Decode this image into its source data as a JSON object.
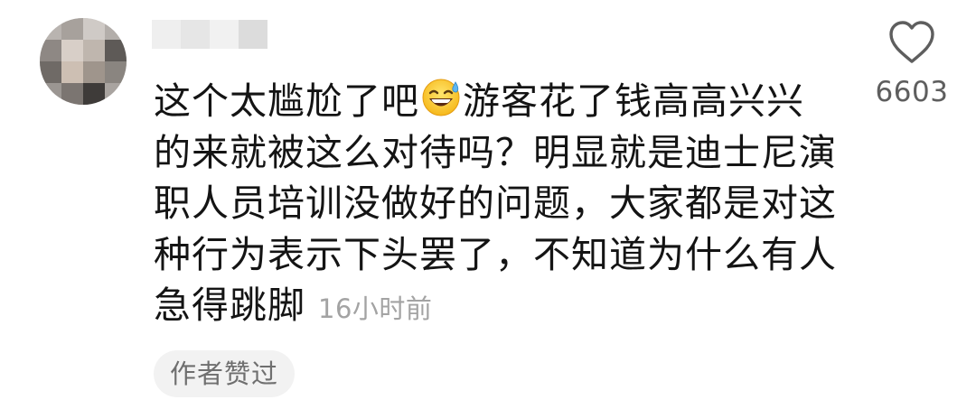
{
  "comment": {
    "text_lines": [
      [
        "这个太尴尬了吧",
        "游客花了钱高高兴兴"
      ],
      "的来就被这么对待吗？明显就是迪士尼演",
      "职人员培训没做好的问题，大家都是对这",
      "种行为表示下头罢了，不知道为什么有人",
      "急得跳脚"
    ],
    "emoji_icon": "sweat-smile-emoji",
    "time": "16小时前",
    "author_liked": "作者赞过",
    "like_count": "6603"
  },
  "icons": {
    "like": "heart-outline-icon"
  },
  "colors": {
    "text": "#141414",
    "secondary": "#a3a3a3",
    "pill_bg": "#f2f2f2",
    "pill_text": "#6f6f6f",
    "icon": "#5e5e5e"
  }
}
